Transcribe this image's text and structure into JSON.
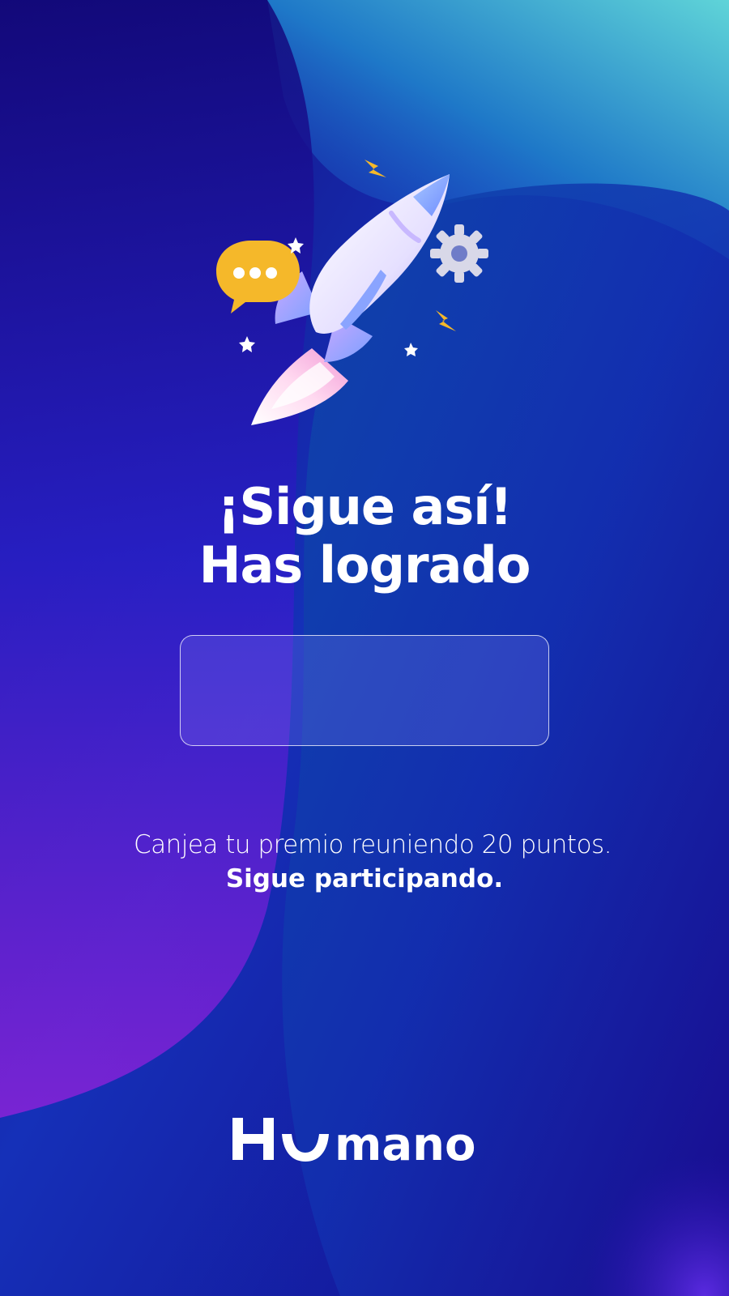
{
  "title": {
    "line1": "¡Sigue así!",
    "line2": "Has logrado"
  },
  "points_box": {
    "value": ""
  },
  "message": {
    "line1": "Canjea tu premio reuniendo 20 puntos.",
    "line2": "Sigue participando."
  },
  "brand": {
    "name": "Humano"
  },
  "colors": {
    "background_deep": "#1a0f8f",
    "background_blue": "#1233b8",
    "background_teal": "#3ab8c8",
    "accent_purple": "#7a1fd6",
    "bubble_yellow": "#f5b82a",
    "text": "#ffffff"
  },
  "icons": [
    "rocket-icon",
    "chat-bubble-icon",
    "gear-icon",
    "lightning-icon",
    "star-icon"
  ]
}
